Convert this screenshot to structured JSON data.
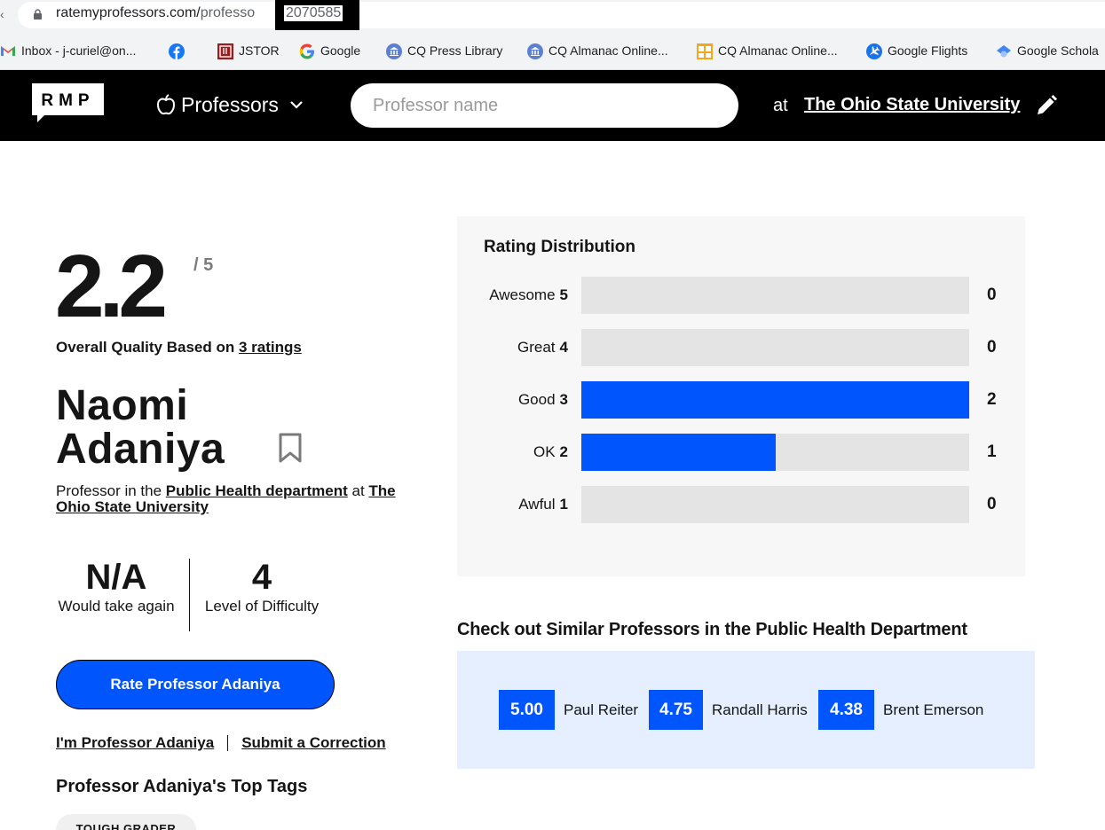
{
  "browser": {
    "url_domain": "ratemyprofessors.com/",
    "url_path": "professo",
    "url_id_redacted": "2070585",
    "bookmarks": [
      {
        "label": "Inbox - j-curiel@on...",
        "icon": "gmail-icon"
      },
      {
        "label": "",
        "icon": "facebook-icon"
      },
      {
        "label": "JSTOR",
        "icon": "jstor-icon"
      },
      {
        "label": "Google",
        "icon": "google-icon"
      },
      {
        "label": "CQ Press Library",
        "icon": "library-icon"
      },
      {
        "label": "CQ Almanac Online...",
        "icon": "library-icon"
      },
      {
        "label": "CQ Almanac Online...",
        "icon": "cq-icon"
      },
      {
        "label": "Google Flights",
        "icon": "flights-icon"
      },
      {
        "label": "Google Schola",
        "icon": "scholar-icon"
      }
    ]
  },
  "header": {
    "logo_text": "RMP",
    "menu_label": "Professors",
    "search_placeholder": "Professor name",
    "at_text": "at",
    "school_name": "The Ohio State University"
  },
  "professor": {
    "rating": "2.2",
    "out_of": "/ 5",
    "overall_prefix": "Overall Quality Based on ",
    "ratings_link": "3 ratings",
    "first_name": "Naomi",
    "last_name": "Adaniya",
    "dept_prefix": "Professor in the ",
    "dept_link": "Public Health department",
    "dept_at": " at ",
    "school_link": "The Ohio State University",
    "would_take_again": "N/A",
    "would_take_again_label": "Would take again",
    "difficulty": "4",
    "difficulty_label": "Level of Difficulty",
    "rate_button": "Rate Professor Adaniya",
    "im_professor_link": "I'm Professor Adaniya",
    "correction_link": "Submit a Correction",
    "top_tags_heading": "Professor Adaniya's Top Tags",
    "tags": [
      "TOUGH GRADER"
    ]
  },
  "distribution": {
    "title": "Rating Distribution",
    "max": 2,
    "colors": {
      "fill": "#0055fd",
      "track": "#e4e4e4"
    },
    "rows": [
      {
        "label": "Awesome",
        "score": "5",
        "count": 0
      },
      {
        "label": "Great",
        "score": "4",
        "count": 0
      },
      {
        "label": "Good",
        "score": "3",
        "count": 2
      },
      {
        "label": "OK",
        "score": "2",
        "count": 1
      },
      {
        "label": "Awful",
        "score": "1",
        "count": 0
      }
    ]
  },
  "similar": {
    "heading": "Check out Similar Professors in the Public Health Department",
    "professors": [
      {
        "score": "5.00",
        "name": "Paul Reiter"
      },
      {
        "score": "4.75",
        "name": "Randall Harris"
      },
      {
        "score": "4.38",
        "name": "Brent Emerson"
      }
    ]
  }
}
